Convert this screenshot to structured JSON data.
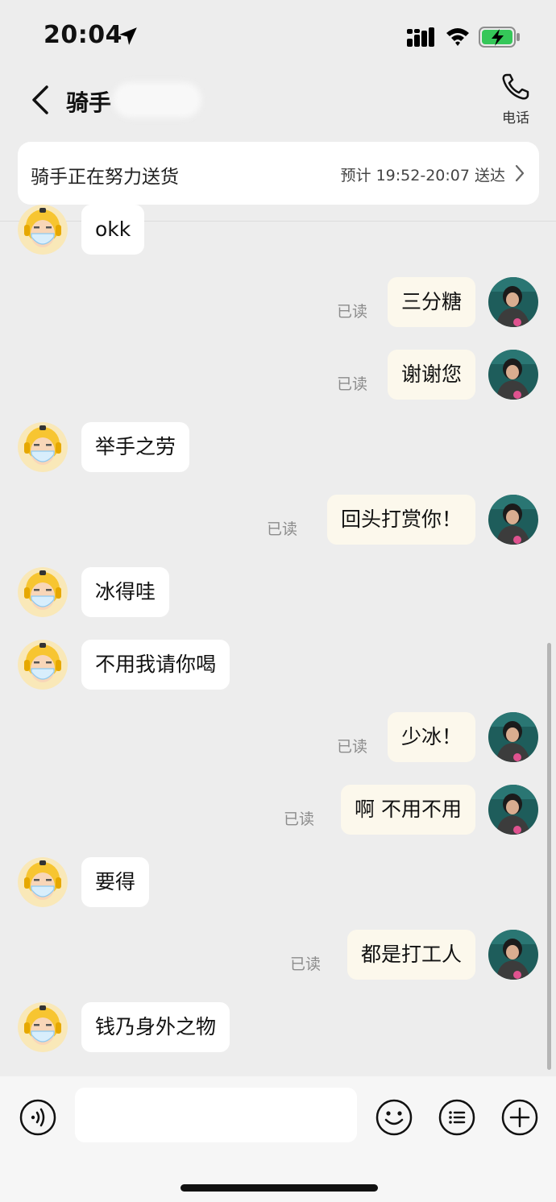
{
  "status_bar": {
    "time": "20:04",
    "icons": [
      "location-arrow-icon",
      "signal-icon",
      "wifi-icon",
      "battery-charging-icon"
    ]
  },
  "header": {
    "title": "骑手",
    "back_icon": "chevron-left-icon",
    "call_icon": "phone-icon",
    "call_label": "电话"
  },
  "delivery": {
    "status": "骑手正在努力送货",
    "eta": "预计 19:52-20:07 送达"
  },
  "messages": [
    {
      "side": "left",
      "text": "okk"
    },
    {
      "side": "right",
      "text": "三分糖",
      "read": "已读"
    },
    {
      "side": "right",
      "text": "谢谢您",
      "read": "已读"
    },
    {
      "side": "left",
      "text": "举手之劳"
    },
    {
      "side": "right",
      "text": "回头打赏你！",
      "read": "已读"
    },
    {
      "side": "left",
      "text": "冰得哇"
    },
    {
      "side": "left",
      "text": "不用我请你喝"
    },
    {
      "side": "right",
      "text": "少冰！",
      "read": "已读"
    },
    {
      "side": "right",
      "text": "啊 不用不用",
      "read": "已读"
    },
    {
      "side": "left",
      "text": "要得"
    },
    {
      "side": "right",
      "text": "都是打工人",
      "read": "已读"
    },
    {
      "side": "left",
      "text": "钱乃身外之物"
    }
  ],
  "input_bar": {
    "placeholder": "",
    "icons": [
      "voice-icon",
      "emoji-icon",
      "quick-reply-icon",
      "plus-icon"
    ]
  },
  "colors": {
    "background": "#ededed",
    "incoming_bubble": "#ffffff",
    "outgoing_bubble": "#fcf8ec",
    "rider_avatar": "#f7c531",
    "user_avatar": "#1e5d5b"
  }
}
